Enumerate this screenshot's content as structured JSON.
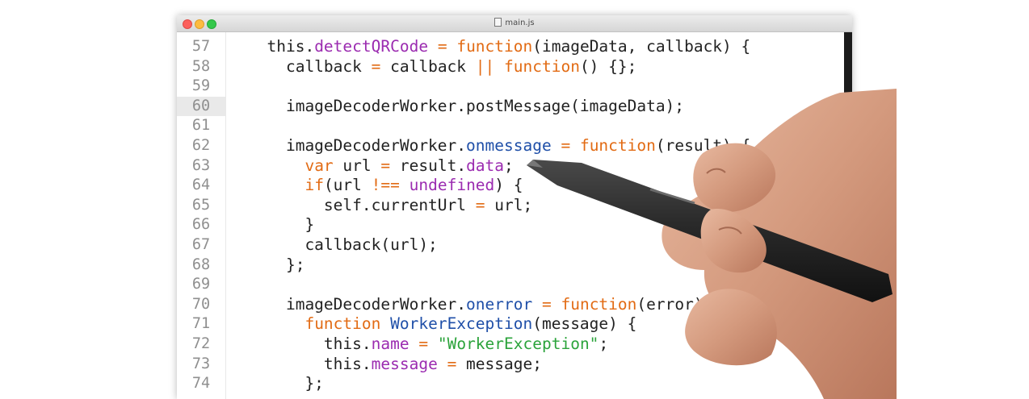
{
  "window": {
    "title": "main.js",
    "file_icon": "file-icon",
    "traffic_lights": {
      "close": "#fc605c",
      "minimize": "#fdbc40",
      "zoom": "#34c84a"
    }
  },
  "editor": {
    "language": "javascript",
    "active_line": "60",
    "colors": {
      "default": "#222222",
      "keyword": "#e26b14",
      "function_name": "#1f4fa8",
      "property": "#9b2bb0",
      "string": "#2ba33b"
    },
    "lines": [
      {
        "number": "57",
        "tokens": [
          {
            "t": "  this.",
            "c": "d"
          },
          {
            "t": "detectQRCode",
            "c": "p"
          },
          {
            "t": " ",
            "c": "d"
          },
          {
            "t": "=",
            "c": "k"
          },
          {
            "t": " ",
            "c": "d"
          },
          {
            "t": "function",
            "c": "k"
          },
          {
            "t": "(imageData, callback) {",
            "c": "d"
          }
        ]
      },
      {
        "number": "58",
        "tokens": [
          {
            "t": "    callback ",
            "c": "d"
          },
          {
            "t": "=",
            "c": "k"
          },
          {
            "t": " callback ",
            "c": "d"
          },
          {
            "t": "||",
            "c": "k"
          },
          {
            "t": " ",
            "c": "d"
          },
          {
            "t": "function",
            "c": "k"
          },
          {
            "t": "() {};",
            "c": "d"
          }
        ]
      },
      {
        "number": "59",
        "tokens": []
      },
      {
        "number": "60",
        "tokens": [
          {
            "t": "    imageDecoderWorker.postMessage(imageData);",
            "c": "d"
          }
        ]
      },
      {
        "number": "61",
        "tokens": []
      },
      {
        "number": "62",
        "tokens": [
          {
            "t": "    imageDecoderWorker.",
            "c": "d"
          },
          {
            "t": "onmessage",
            "c": "f"
          },
          {
            "t": " ",
            "c": "d"
          },
          {
            "t": "=",
            "c": "k"
          },
          {
            "t": " ",
            "c": "d"
          },
          {
            "t": "function",
            "c": "k"
          },
          {
            "t": "(result) {",
            "c": "d"
          }
        ]
      },
      {
        "number": "63",
        "tokens": [
          {
            "t": "      ",
            "c": "d"
          },
          {
            "t": "var",
            "c": "k"
          },
          {
            "t": " url ",
            "c": "d"
          },
          {
            "t": "=",
            "c": "k"
          },
          {
            "t": " result.",
            "c": "d"
          },
          {
            "t": "data",
            "c": "p"
          },
          {
            "t": ";",
            "c": "d"
          }
        ]
      },
      {
        "number": "64",
        "tokens": [
          {
            "t": "      ",
            "c": "d"
          },
          {
            "t": "if",
            "c": "k"
          },
          {
            "t": "(url ",
            "c": "d"
          },
          {
            "t": "!==",
            "c": "k"
          },
          {
            "t": " ",
            "c": "d"
          },
          {
            "t": "undefined",
            "c": "p"
          },
          {
            "t": ") {",
            "c": "d"
          }
        ]
      },
      {
        "number": "65",
        "tokens": [
          {
            "t": "        self.currentUrl ",
            "c": "d"
          },
          {
            "t": "=",
            "c": "k"
          },
          {
            "t": " url;",
            "c": "d"
          }
        ]
      },
      {
        "number": "66",
        "tokens": [
          {
            "t": "      }",
            "c": "d"
          }
        ]
      },
      {
        "number": "67",
        "tokens": [
          {
            "t": "      callback(url);",
            "c": "d"
          }
        ]
      },
      {
        "number": "68",
        "tokens": [
          {
            "t": "    };",
            "c": "d"
          }
        ]
      },
      {
        "number": "69",
        "tokens": []
      },
      {
        "number": "70",
        "tokens": [
          {
            "t": "    imageDecoderWorker.",
            "c": "d"
          },
          {
            "t": "onerror",
            "c": "f"
          },
          {
            "t": " ",
            "c": "d"
          },
          {
            "t": "=",
            "c": "k"
          },
          {
            "t": " ",
            "c": "d"
          },
          {
            "t": "function",
            "c": "k"
          },
          {
            "t": "(error) {",
            "c": "d"
          }
        ]
      },
      {
        "number": "71",
        "tokens": [
          {
            "t": "      ",
            "c": "d"
          },
          {
            "t": "function",
            "c": "k"
          },
          {
            "t": " ",
            "c": "d"
          },
          {
            "t": "WorkerException",
            "c": "f"
          },
          {
            "t": "(message) {",
            "c": "d"
          }
        ]
      },
      {
        "number": "72",
        "tokens": [
          {
            "t": "        this.",
            "c": "d"
          },
          {
            "t": "name",
            "c": "p"
          },
          {
            "t": " ",
            "c": "d"
          },
          {
            "t": "=",
            "c": "k"
          },
          {
            "t": " ",
            "c": "d"
          },
          {
            "t": "\"WorkerException\"",
            "c": "s"
          },
          {
            "t": ";",
            "c": "d"
          }
        ]
      },
      {
        "number": "73",
        "tokens": [
          {
            "t": "        this.",
            "c": "d"
          },
          {
            "t": "message",
            "c": "p"
          },
          {
            "t": " ",
            "c": "d"
          },
          {
            "t": "=",
            "c": "k"
          },
          {
            "t": " message;",
            "c": "d"
          }
        ]
      },
      {
        "number": "74",
        "tokens": [
          {
            "t": "      };",
            "c": "d"
          }
        ]
      }
    ]
  },
  "overlay": {
    "hand_icon": "hand-holding-pen-icon"
  }
}
